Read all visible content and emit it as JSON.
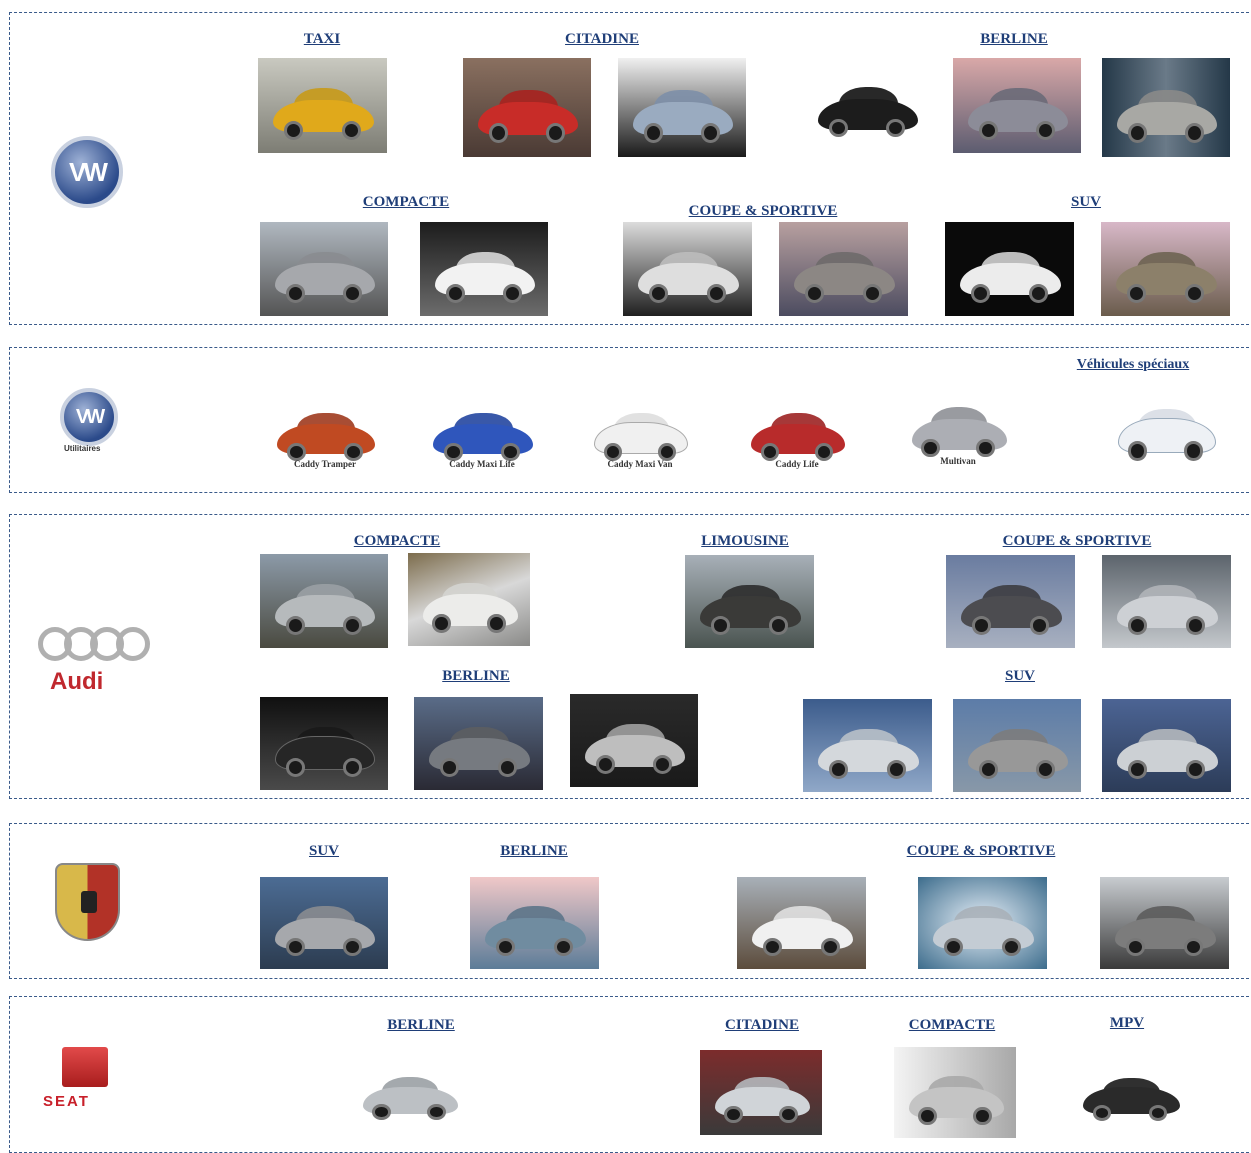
{
  "sections": {
    "vw": {
      "brand": "volkswagen-logo",
      "categories": {
        "taxi": "TAXI",
        "citadine": "CITADINE",
        "berline": "BERLINE",
        "compacte": "COMPACTE",
        "coupe": "COUPE & SPORTIVE",
        "suv": "SUV"
      }
    },
    "vwu": {
      "brand": "volkswagen-utilitaires-logo",
      "logo_text": "Utilitaires",
      "categories": {
        "speciaux": "Véhicules spéciaux"
      },
      "captions": [
        "Caddy Tramper",
        "Caddy Maxi Life",
        "Caddy Maxi Van",
        "Caddy Life",
        "Multivan"
      ]
    },
    "audi": {
      "brand": "audi-logo",
      "logo_text": "Audi",
      "categories": {
        "compacte": "COMPACTE",
        "limousine": "LIMOUSINE",
        "coupe": "COUPE & SPORTIVE",
        "berline": "BERLINE",
        "suv": "SUV"
      }
    },
    "porsche": {
      "brand": "porsche-logo",
      "categories": {
        "suv": "SUV",
        "berline": "BERLINE",
        "coupe": "COUPE & SPORTIVE"
      }
    },
    "seat": {
      "brand": "seat-logo",
      "logo_text": "SEAT",
      "categories": {
        "berline": "BERLINE",
        "citadine": "CITADINE",
        "compacte": "COMPACTE",
        "mpv": "MPV"
      }
    }
  },
  "colors": {
    "link": "#1f3e78",
    "border": "#3a5a8a",
    "audi_red": "#c0282e",
    "seat_red": "#c8202a"
  }
}
